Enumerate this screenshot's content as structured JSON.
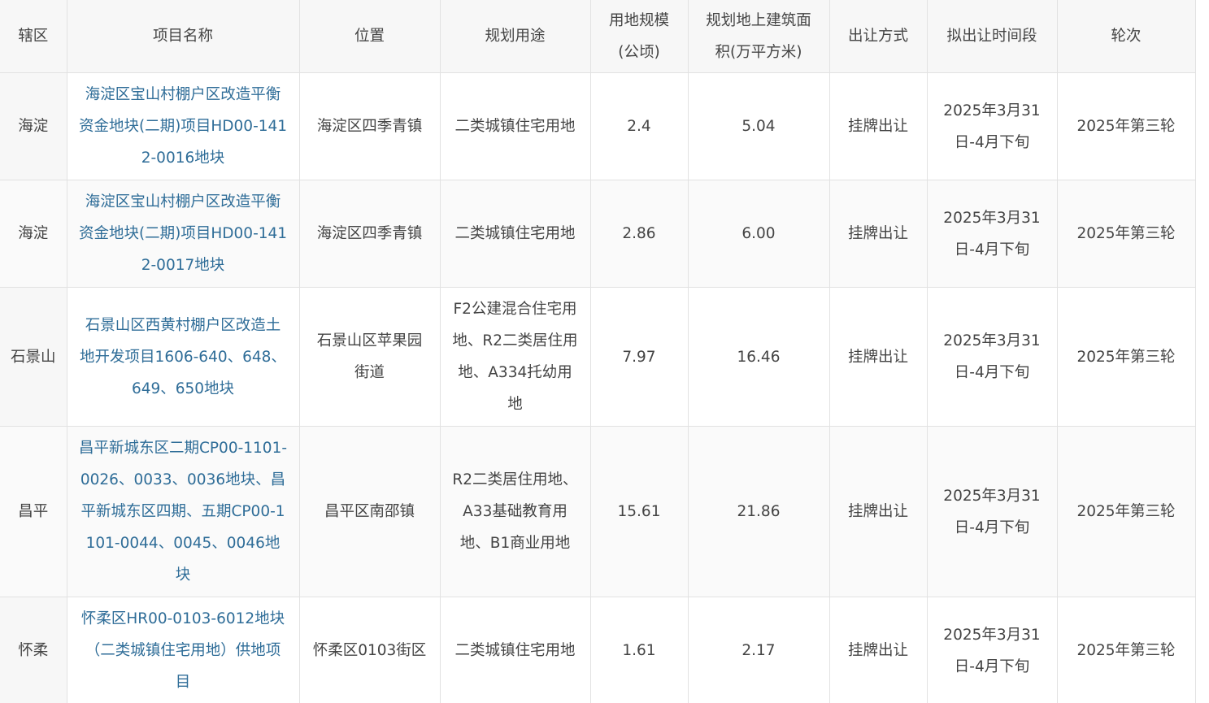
{
  "headers": {
    "district": "辖区",
    "project": "项目名称",
    "location": "位置",
    "use": "规划用途",
    "area": "用地规模(公顷)",
    "floor_area": "规划地上建筑面积(万平方米)",
    "method": "出让方式",
    "period": "拟出让时间段",
    "round": "轮次"
  },
  "rows": [
    {
      "district": "海淀",
      "project": "海淀区宝山村棚户区改造平衡资金地块(二期)项目HD00-1412-0016地块",
      "location": "海淀区四季青镇",
      "use": "二类城镇住宅用地",
      "area": "2.4",
      "floor_area": "5.04",
      "method": "挂牌出让",
      "period": "2025年3月31日-4月下旬",
      "round": "2025年第三轮"
    },
    {
      "district": "海淀",
      "project": "海淀区宝山村棚户区改造平衡资金地块(二期)项目HD00-1412-0017地块",
      "location": "海淀区四季青镇",
      "use": "二类城镇住宅用地",
      "area": "2.86",
      "floor_area": "6.00",
      "method": "挂牌出让",
      "period": "2025年3月31日-4月下旬",
      "round": "2025年第三轮"
    },
    {
      "district": "石景山",
      "project": "石景山区西黄村棚户区改造土地开发项目1606-640、648、649、650地块",
      "location": "石景山区苹果园街道",
      "use": "F2公建混合住宅用地、R2二类居住用地、A334托幼用地",
      "area": "7.97",
      "floor_area": "16.46",
      "method": "挂牌出让",
      "period": "2025年3月31日-4月下旬",
      "round": "2025年第三轮"
    },
    {
      "district": "昌平",
      "project": "昌平新城东区二期CP00-1101-0026、0033、0036地块、昌平新城东区四期、五期CP00-1101-0044、0045、0046地块",
      "location": "昌平区南邵镇",
      "use": "R2二类居住用地、A33基础教育用地、B1商业用地",
      "area": "15.61",
      "floor_area": "21.86",
      "method": "挂牌出让",
      "period": "2025年3月31日-4月下旬",
      "round": "2025年第三轮"
    },
    {
      "district": "怀柔",
      "project": "怀柔区HR00-0103-6012地块（二类城镇住宅用地）供地项目",
      "location": "怀柔区0103街区",
      "use": "二类城镇住宅用地",
      "area": "1.61",
      "floor_area": "2.17",
      "method": "挂牌出让",
      "period": "2025年3月31日-4月下旬",
      "round": "2025年第三轮"
    }
  ],
  "colors": {
    "link": "#2f6d98",
    "text": "#444444",
    "header_bg": "#f7f7f7",
    "border": "#e2e2e2"
  }
}
